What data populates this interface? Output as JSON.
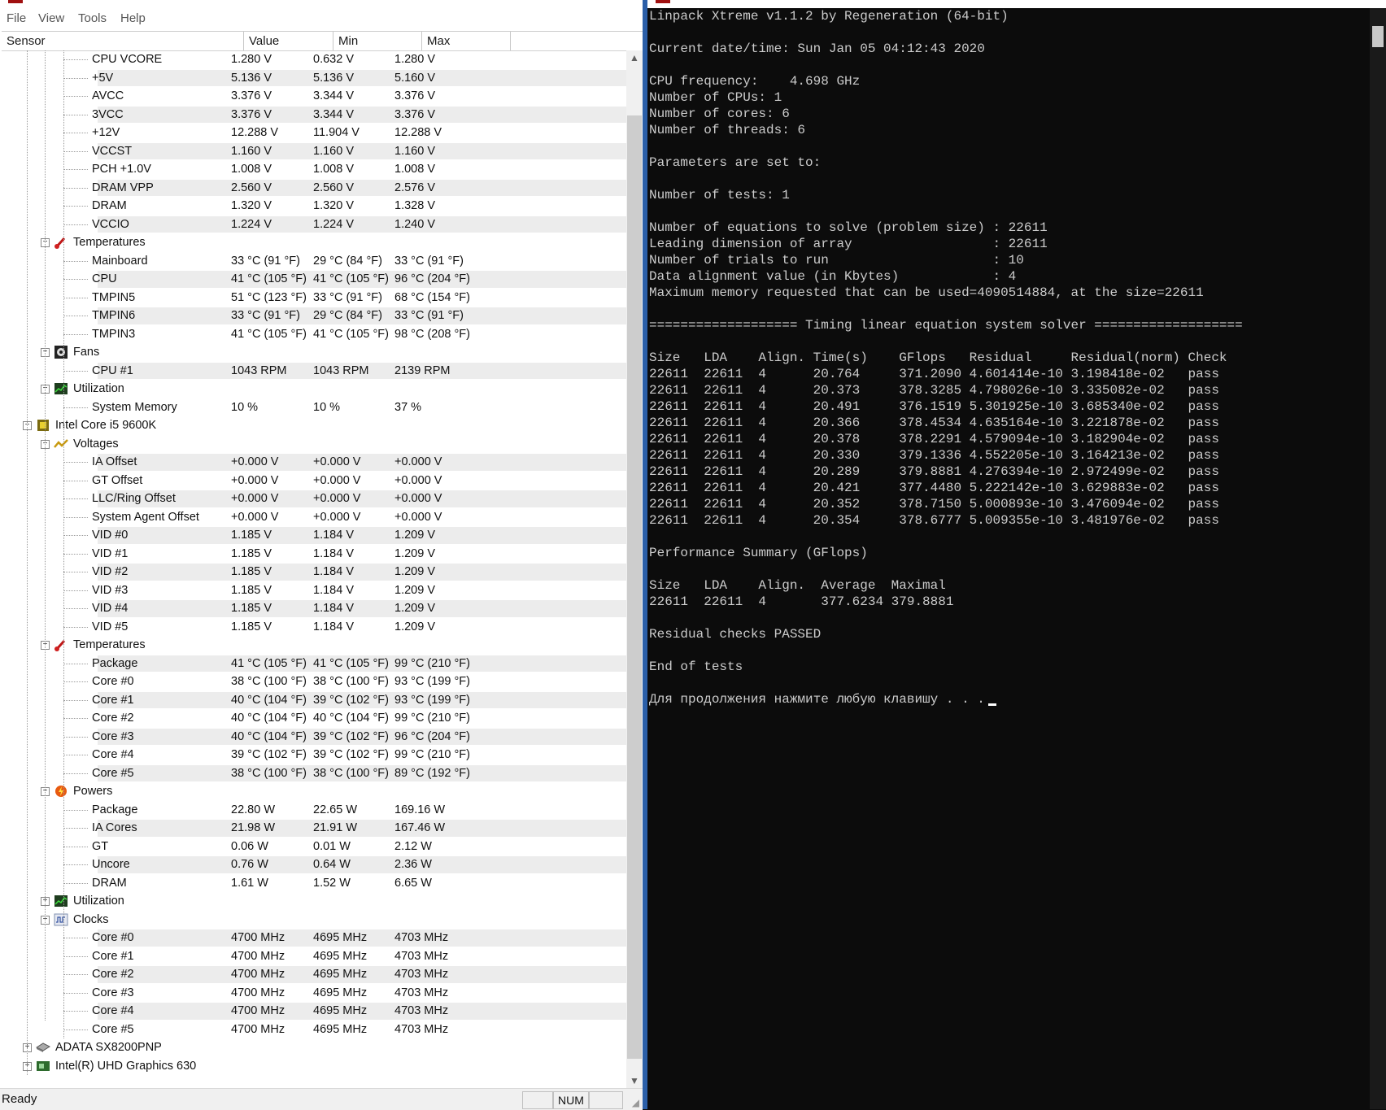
{
  "menu": [
    "File",
    "View",
    "Tools",
    "Help"
  ],
  "columns": [
    "Sensor",
    "Value",
    "Min",
    "Max"
  ],
  "tree": [
    {
      "type": "leaf",
      "label": "CPU VCORE",
      "value": "1.280 V",
      "min": "0.632 V",
      "max": "1.280 V"
    },
    {
      "type": "leaf",
      "label": "+5V",
      "value": "5.136 V",
      "min": "5.136 V",
      "max": "5.160 V"
    },
    {
      "type": "leaf",
      "label": "AVCC",
      "value": "3.376 V",
      "min": "3.344 V",
      "max": "3.376 V"
    },
    {
      "type": "leaf",
      "label": "3VCC",
      "value": "3.376 V",
      "min": "3.344 V",
      "max": "3.376 V"
    },
    {
      "type": "leaf",
      "label": "+12V",
      "value": "12.288 V",
      "min": "11.904 V",
      "max": "12.288 V"
    },
    {
      "type": "leaf",
      "label": "VCCST",
      "value": "1.160 V",
      "min": "1.160 V",
      "max": "1.160 V"
    },
    {
      "type": "leaf",
      "label": "PCH +1.0V",
      "value": "1.008 V",
      "min": "1.008 V",
      "max": "1.008 V"
    },
    {
      "type": "leaf",
      "label": "DRAM VPP",
      "value": "2.560 V",
      "min": "2.560 V",
      "max": "2.576 V"
    },
    {
      "type": "leaf",
      "label": "DRAM",
      "value": "1.320 V",
      "min": "1.320 V",
      "max": "1.328 V"
    },
    {
      "type": "leaf",
      "label": "VCCIO",
      "value": "1.224 V",
      "min": "1.224 V",
      "max": "1.240 V"
    },
    {
      "type": "cat",
      "label": "Temperatures",
      "icon": "thermometer-icon",
      "expanded": true
    },
    {
      "type": "leaf",
      "label": "Mainboard",
      "value": "33 °C (91 °F)",
      "min": "29 °C (84 °F)",
      "max": "33 °C (91 °F)"
    },
    {
      "type": "leaf",
      "label": "CPU",
      "value": "41 °C (105 °F)",
      "min": "41 °C (105 °F)",
      "max": "96 °C (204 °F)"
    },
    {
      "type": "leaf",
      "label": "TMPIN5",
      "value": "51 °C (123 °F)",
      "min": "33 °C (91 °F)",
      "max": "68 °C (154 °F)"
    },
    {
      "type": "leaf",
      "label": "TMPIN6",
      "value": "33 °C (91 °F)",
      "min": "29 °C (84 °F)",
      "max": "33 °C (91 °F)"
    },
    {
      "type": "leaf",
      "label": "TMPIN3",
      "value": "41 °C (105 °F)",
      "min": "41 °C (105 °F)",
      "max": "98 °C (208 °F)"
    },
    {
      "type": "cat",
      "label": "Fans",
      "icon": "fan-icon",
      "expanded": true
    },
    {
      "type": "leaf",
      "label": "CPU #1",
      "value": "1043 RPM",
      "min": "1043 RPM",
      "max": "2139 RPM"
    },
    {
      "type": "cat",
      "label": "Utilization",
      "icon": "utilization-icon",
      "expanded": true
    },
    {
      "type": "leaf",
      "label": "System Memory",
      "value": "10 %",
      "min": "10 %",
      "max": "37 %"
    },
    {
      "type": "device",
      "label": "Intel Core i5 9600K",
      "icon": "cpu-chip-icon",
      "expanded": true
    },
    {
      "type": "cat",
      "label": "Voltages",
      "icon": "voltage-icon",
      "expanded": true
    },
    {
      "type": "leaf",
      "label": "IA Offset",
      "value": "+0.000 V",
      "min": "+0.000 V",
      "max": "+0.000 V"
    },
    {
      "type": "leaf",
      "label": "GT Offset",
      "value": "+0.000 V",
      "min": "+0.000 V",
      "max": "+0.000 V"
    },
    {
      "type": "leaf",
      "label": "LLC/Ring Offset",
      "value": "+0.000 V",
      "min": "+0.000 V",
      "max": "+0.000 V"
    },
    {
      "type": "leaf",
      "label": "System Agent Offset",
      "value": "+0.000 V",
      "min": "+0.000 V",
      "max": "+0.000 V"
    },
    {
      "type": "leaf",
      "label": "VID #0",
      "value": "1.185 V",
      "min": "1.184 V",
      "max": "1.209 V"
    },
    {
      "type": "leaf",
      "label": "VID #1",
      "value": "1.185 V",
      "min": "1.184 V",
      "max": "1.209 V"
    },
    {
      "type": "leaf",
      "label": "VID #2",
      "value": "1.185 V",
      "min": "1.184 V",
      "max": "1.209 V"
    },
    {
      "type": "leaf",
      "label": "VID #3",
      "value": "1.185 V",
      "min": "1.184 V",
      "max": "1.209 V"
    },
    {
      "type": "leaf",
      "label": "VID #4",
      "value": "1.185 V",
      "min": "1.184 V",
      "max": "1.209 V"
    },
    {
      "type": "leaf",
      "label": "VID #5",
      "value": "1.185 V",
      "min": "1.184 V",
      "max": "1.209 V"
    },
    {
      "type": "cat",
      "label": "Temperatures",
      "icon": "thermometer-icon",
      "expanded": true
    },
    {
      "type": "leaf",
      "label": "Package",
      "value": "41 °C (105 °F)",
      "min": "41 °C (105 °F)",
      "max": "99 °C (210 °F)"
    },
    {
      "type": "leaf",
      "label": "Core #0",
      "value": "38 °C (100 °F)",
      "min": "38 °C (100 °F)",
      "max": "93 °C (199 °F)"
    },
    {
      "type": "leaf",
      "label": "Core #1",
      "value": "40 °C (104 °F)",
      "min": "39 °C (102 °F)",
      "max": "93 °C (199 °F)"
    },
    {
      "type": "leaf",
      "label": "Core #2",
      "value": "40 °C (104 °F)",
      "min": "40 °C (104 °F)",
      "max": "99 °C (210 °F)"
    },
    {
      "type": "leaf",
      "label": "Core #3",
      "value": "40 °C (104 °F)",
      "min": "39 °C (102 °F)",
      "max": "96 °C (204 °F)"
    },
    {
      "type": "leaf",
      "label": "Core #4",
      "value": "39 °C (102 °F)",
      "min": "39 °C (102 °F)",
      "max": "99 °C (210 °F)"
    },
    {
      "type": "leaf",
      "label": "Core #5",
      "value": "38 °C (100 °F)",
      "min": "38 °C (100 °F)",
      "max": "89 °C (192 °F)"
    },
    {
      "type": "cat",
      "label": "Powers",
      "icon": "power-icon",
      "expanded": true
    },
    {
      "type": "leaf",
      "label": "Package",
      "value": "22.80 W",
      "min": "22.65 W",
      "max": "169.16 W"
    },
    {
      "type": "leaf",
      "label": "IA Cores",
      "value": "21.98 W",
      "min": "21.91 W",
      "max": "167.46 W"
    },
    {
      "type": "leaf",
      "label": "GT",
      "value": "0.06 W",
      "min": "0.01 W",
      "max": "2.12 W"
    },
    {
      "type": "leaf",
      "label": "Uncore",
      "value": "0.76 W",
      "min": "0.64 W",
      "max": "2.36 W"
    },
    {
      "type": "leaf",
      "label": "DRAM",
      "value": "1.61 W",
      "min": "1.52 W",
      "max": "6.65 W"
    },
    {
      "type": "cat",
      "label": "Utilization",
      "icon": "utilization-icon",
      "expanded": false
    },
    {
      "type": "cat",
      "label": "Clocks",
      "icon": "clock-icon",
      "expanded": true
    },
    {
      "type": "leaf",
      "label": "Core #0",
      "value": "4700 MHz",
      "min": "4695 MHz",
      "max": "4703 MHz"
    },
    {
      "type": "leaf",
      "label": "Core #1",
      "value": "4700 MHz",
      "min": "4695 MHz",
      "max": "4703 MHz"
    },
    {
      "type": "leaf",
      "label": "Core #2",
      "value": "4700 MHz",
      "min": "4695 MHz",
      "max": "4703 MHz"
    },
    {
      "type": "leaf",
      "label": "Core #3",
      "value": "4700 MHz",
      "min": "4695 MHz",
      "max": "4703 MHz"
    },
    {
      "type": "leaf",
      "label": "Core #4",
      "value": "4700 MHz",
      "min": "4695 MHz",
      "max": "4703 MHz"
    },
    {
      "type": "leaf",
      "label": "Core #5",
      "value": "4700 MHz",
      "min": "4695 MHz",
      "max": "4703 MHz"
    },
    {
      "type": "device",
      "label": "ADATA SX8200PNP",
      "icon": "drive-icon",
      "expanded": false
    },
    {
      "type": "device",
      "label": "Intel(R) UHD Graphics 630",
      "icon": "gpu-icon",
      "expanded": false
    }
  ],
  "status": {
    "text": "Ready",
    "num": "NUM"
  },
  "console": {
    "lines": [
      "Linpack Xtreme v1.1.2 by Regeneration (64-bit)",
      "",
      "Current date/time: Sun Jan 05 04:12:43 2020",
      "",
      "CPU frequency:    4.698 GHz",
      "Number of CPUs: 1",
      "Number of cores: 6",
      "Number of threads: 6",
      "",
      "Parameters are set to:",
      "",
      "Number of tests: 1",
      "",
      "Number of equations to solve (problem size) : 22611",
      "Leading dimension of array                  : 22611",
      "Number of trials to run                     : 10",
      "Data alignment value (in Kbytes)            : 4",
      "Maximum memory requested that can be used=4090514884, at the size=22611",
      "",
      "=================== Timing linear equation system solver ===================",
      "",
      "Size   LDA    Align. Time(s)    GFlops   Residual     Residual(norm) Check",
      "22611  22611  4      20.764     371.2090 4.601414e-10 3.198418e-02   pass",
      "22611  22611  4      20.373     378.3285 4.798026e-10 3.335082e-02   pass",
      "22611  22611  4      20.491     376.1519 5.301925e-10 3.685340e-02   pass",
      "22611  22611  4      20.366     378.4534 4.635164e-10 3.221878e-02   pass",
      "22611  22611  4      20.378     378.2291 4.579094e-10 3.182904e-02   pass",
      "22611  22611  4      20.330     379.1336 4.552205e-10 3.164213e-02   pass",
      "22611  22611  4      20.289     379.8881 4.276394e-10 2.972499e-02   pass",
      "22611  22611  4      20.421     377.4480 5.222142e-10 3.629883e-02   pass",
      "22611  22611  4      20.352     378.7150 5.000893e-10 3.476094e-02   pass",
      "22611  22611  4      20.354     378.6777 5.009355e-10 3.481976e-02   pass",
      "",
      "Performance Summary (GFlops)",
      "",
      "Size   LDA    Align.  Average  Maximal",
      "22611  22611  4       377.6234 379.8881",
      "",
      "Residual checks PASSED",
      "",
      "End of tests",
      "",
      "Для продолжения нажмите любую клавишу . . ."
    ]
  }
}
